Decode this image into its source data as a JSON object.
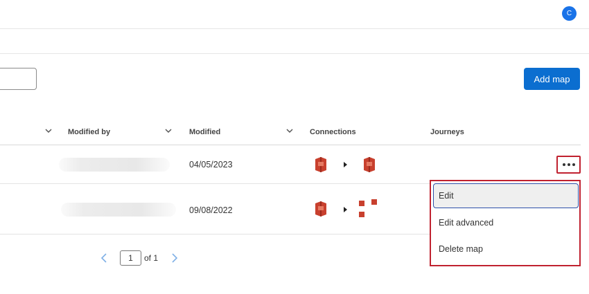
{
  "header": {
    "avatar_initial": "C"
  },
  "toolbar": {
    "add_map_label": "Add map"
  },
  "table": {
    "columns": [
      "Modified by",
      "Modified",
      "Connections",
      "Journeys"
    ],
    "rows": [
      {
        "modified": "04/05/2023",
        "connections": [
          "salesforce-icon",
          "salesforce-icon"
        ]
      },
      {
        "modified": "09/08/2022",
        "connections": [
          "salesforce-icon",
          "multi-object-icon"
        ]
      }
    ]
  },
  "menu": {
    "items": [
      "Edit",
      "Edit advanced",
      "Delete map"
    ]
  },
  "pagination": {
    "page": "1",
    "of_label": "of 1"
  },
  "colors": {
    "accent": "#0b6ed0",
    "highlight": "#c0212f",
    "connector": "#c8402e"
  }
}
